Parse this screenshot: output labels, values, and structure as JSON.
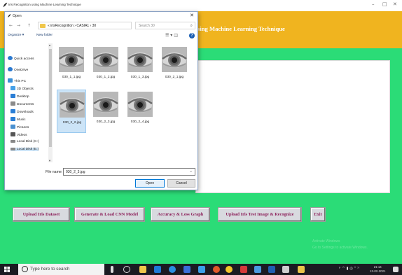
{
  "app": {
    "title": "Iris Recognition using Machine Learning Technique",
    "header_title": "sing Machine Learning Technique",
    "win_minimize": "–",
    "win_maximize": "□",
    "win_close": "✕",
    "buttons": [
      {
        "label": "Upload Iris Dataset"
      },
      {
        "label": "Generate & Load CNN Model"
      },
      {
        "label": "Accuracy & Loss Graph"
      },
      {
        "label": "Upload Iris Test Image & Recognize"
      },
      {
        "label": "Exit"
      }
    ],
    "watermark_line1": "Activate Windows",
    "watermark_line2": "Go to Settings to activate Windows."
  },
  "dialog": {
    "title": "Open",
    "close": "✕",
    "nav_back": "←",
    "nav_forward": "→",
    "nav_up": "↑",
    "address_path": "« irisRecognition › CASIA1 › 30",
    "address_chevron": "⌄",
    "address_refresh": "↻",
    "search_placeholder": "Search 30",
    "search_icon": "⌕",
    "organize": "Organize ▾",
    "new_folder": "New folder",
    "view_icons": "☰ ▾  ◫",
    "help": "?",
    "nav_pane": [
      {
        "label": "Quick access",
        "icon": "star-icon",
        "color": "#2b79d0"
      },
      {
        "label": "OneDrive",
        "icon": "cloud-icon",
        "color": "#2b79d0"
      },
      {
        "label": "This PC",
        "icon": "computer-icon",
        "color": "#3a8fd8"
      },
      {
        "label": "3D Objects",
        "icon": "cube-icon",
        "color": "#45a0e8"
      },
      {
        "label": "Desktop",
        "icon": "desktop-icon",
        "color": "#2a7ed6"
      },
      {
        "label": "Documents",
        "icon": "document-icon",
        "color": "#8a8a8a"
      },
      {
        "label": "Downloads",
        "icon": "download-icon",
        "color": "#2a7ed6"
      },
      {
        "label": "Music",
        "icon": "music-icon",
        "color": "#2a7ed6"
      },
      {
        "label": "Pictures",
        "icon": "picture-icon",
        "color": "#4a90d0"
      },
      {
        "label": "Videos",
        "icon": "video-icon",
        "color": "#555555"
      },
      {
        "label": "Local Disk (C:)",
        "icon": "disk-icon",
        "color": "#888888"
      },
      {
        "label": "Local Disk (E:)",
        "icon": "disk-icon",
        "color": "#888888"
      }
    ],
    "files": [
      {
        "name": "030_1_1.jpg"
      },
      {
        "name": "030_1_2.jpg"
      },
      {
        "name": "030_1_3.jpg"
      },
      {
        "name": "030_2_1.jpg"
      },
      {
        "name": "030_2_2.jpg"
      },
      {
        "name": "030_2_3.jpg"
      },
      {
        "name": "030_2_4.jpg"
      }
    ],
    "selected_file_index": 4,
    "filename_label": "File name:",
    "filename_value": "030_2_3.jpg",
    "filename_dropdown": "⌄",
    "open_label": "Open",
    "cancel_label": "Cancel"
  },
  "taskbar": {
    "search_placeholder": "Type here to search",
    "tray": "ᵖ ^ ▮ ◎ 🙷 ⁾⁾",
    "time": "21:14",
    "date": "13-02-2021"
  }
}
